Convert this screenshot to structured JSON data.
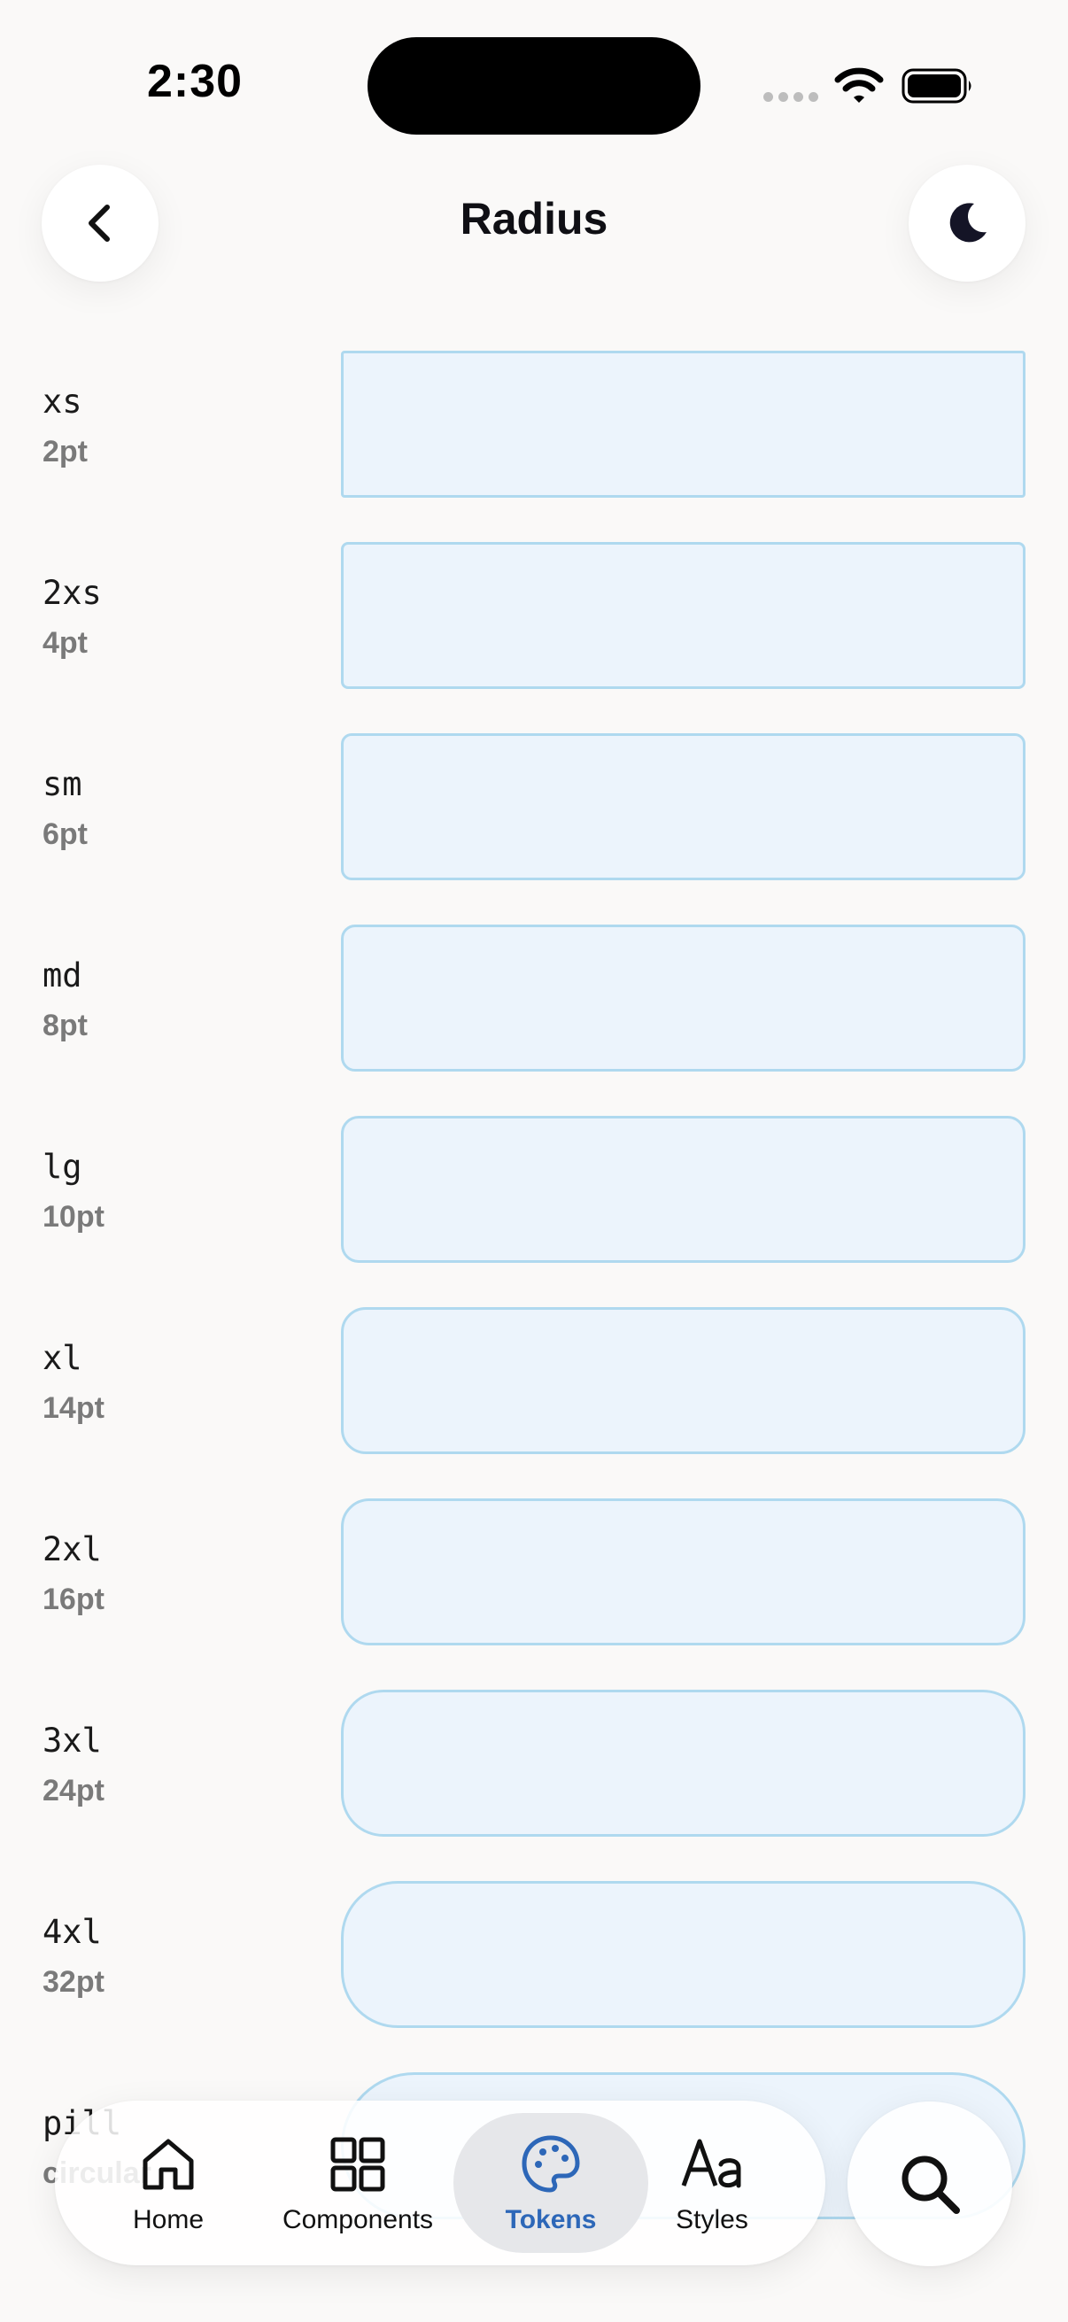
{
  "status_bar": {
    "time": "2:30"
  },
  "header": {
    "title": "Radius"
  },
  "tokens": [
    {
      "name": "xs",
      "value": "2pt"
    },
    {
      "name": "2xs",
      "value": "4pt"
    },
    {
      "name": "sm",
      "value": "6pt"
    },
    {
      "name": "md",
      "value": "8pt"
    },
    {
      "name": "lg",
      "value": "10pt"
    },
    {
      "name": "xl",
      "value": "14pt"
    },
    {
      "name": "2xl",
      "value": "16pt"
    },
    {
      "name": "3xl",
      "value": "24pt"
    },
    {
      "name": "4xl",
      "value": "32pt"
    },
    {
      "name": "pill",
      "value": "circular"
    }
  ],
  "tab_bar": {
    "items": [
      {
        "label": "Home",
        "icon": "house-icon",
        "active": false
      },
      {
        "label": "Components",
        "icon": "grid-icon",
        "active": false
      },
      {
        "label": "Tokens",
        "icon": "palette-icon",
        "active": true
      },
      {
        "label": "Styles",
        "icon": "text-style-icon",
        "active": false
      }
    ]
  },
  "icons": {
    "back": "chevron-left-icon",
    "theme": "moon-icon",
    "search": "magnifier-icon"
  },
  "colors": {
    "background": "#faf9f8",
    "swatch_fill": "#ecf4fc",
    "swatch_border": "#afd9ef",
    "accent": "#2d67b8"
  }
}
